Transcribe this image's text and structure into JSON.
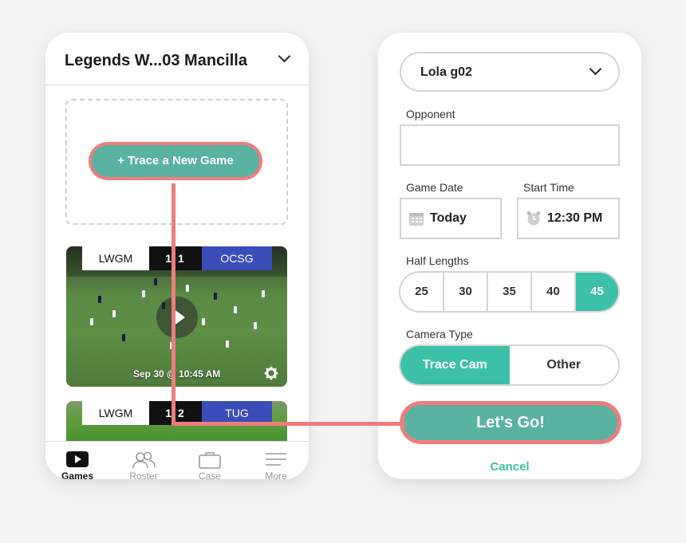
{
  "left_phone": {
    "header_title": "Legends W...03 Mancilla",
    "trace_button": "+ Trace a New Game",
    "cards": [
      {
        "home": "LWGM",
        "score": "1 1",
        "away": "OCSG",
        "date": "Sep 30 @ 10:45 AM"
      },
      {
        "home": "LWGM",
        "score": "1 2",
        "away": "TUG"
      }
    ],
    "nav": [
      {
        "label": "Games",
        "icon": "play-icon"
      },
      {
        "label": "Roster",
        "icon": "people-icon"
      },
      {
        "label": "Case",
        "icon": "briefcase-icon"
      },
      {
        "label": "More",
        "icon": "menu-icon"
      }
    ]
  },
  "right_phone": {
    "team_select": "Lola g02",
    "opponent_label": "Opponent",
    "opponent_value": "",
    "game_date_label": "Game Date",
    "game_date_value": "Today",
    "start_time_label": "Start Time",
    "start_time_value": "12:30 PM",
    "half_lengths_label": "Half Lengths",
    "half_lengths": [
      "25",
      "30",
      "35",
      "40",
      "45"
    ],
    "half_length_selected": "45",
    "camera_type_label": "Camera Type",
    "camera_types": [
      "Trace Cam",
      "Other"
    ],
    "camera_selected": "Trace Cam",
    "go_button": "Let's Go!",
    "cancel": "Cancel"
  },
  "colors": {
    "teal": "#3cc1a7",
    "button_teal": "#59b3a0",
    "highlight": "#ee7d7d",
    "away_team": "#3a4db8"
  }
}
